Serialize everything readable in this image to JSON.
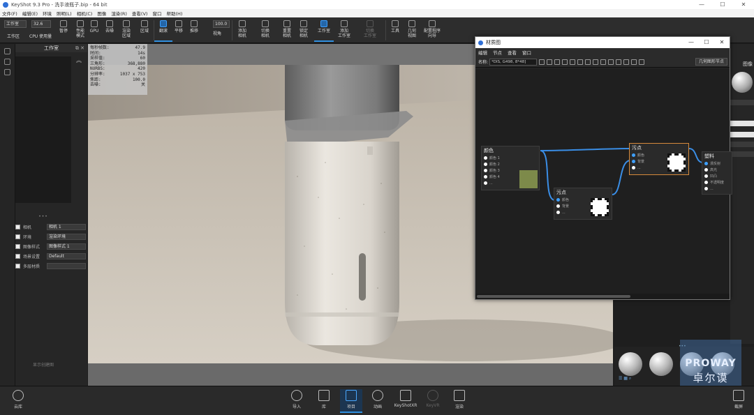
{
  "window": {
    "title": "KeyShot 9.3 Pro  -  洗手液瓶子.bip  -  64 bit",
    "controls": [
      "—",
      "☐",
      "✕"
    ]
  },
  "menu": [
    "文件(F)",
    "编辑(E)",
    "环境",
    "照明(L)",
    "相机(C)",
    "图像",
    "渲染(R)",
    "查看(V)",
    "窗口",
    "帮助(H)"
  ],
  "toolbar": {
    "workspace_value": "工作室",
    "workspace_label": "工作区",
    "cpu_value": "32.6",
    "cpu_label": "CPU 使用量",
    "zoom_value": "100.0",
    "items": [
      {
        "key": "pause",
        "label": "暂停"
      },
      {
        "key": "perf",
        "label": "性能\n模式"
      },
      {
        "key": "gpu",
        "label": "GPU"
      },
      {
        "key": "denoise",
        "label": "去噪"
      },
      {
        "key": "render",
        "label": "渲染\n区域"
      },
      {
        "key": "region",
        "label": "区域"
      },
      {
        "key": "tumble",
        "label": "翻滚"
      },
      {
        "key": "pan",
        "label": "平移"
      },
      {
        "key": "dolly",
        "label": "推移"
      },
      {
        "key": "fov",
        "label": "视角"
      },
      {
        "key": "addcam",
        "label": "添加\n相机"
      },
      {
        "key": "switchcam",
        "label": "切换\n相机"
      },
      {
        "key": "resetcam",
        "label": "重置\n相机"
      },
      {
        "key": "lockcam",
        "label": "锁定\n相机"
      },
      {
        "key": "studio",
        "label": "工作室"
      },
      {
        "key": "addstudio",
        "label": "添加\n工作室"
      },
      {
        "key": "switchstudio",
        "label": "切换\n工作室"
      },
      {
        "key": "tools",
        "label": "工具"
      },
      {
        "key": "geoview",
        "label": "几何\n视图"
      },
      {
        "key": "config",
        "label": "配置程序\n向导"
      }
    ]
  },
  "left_panel": {
    "title": "工作室",
    "footer": "显示创建图",
    "rows": [
      {
        "name": "相机",
        "value": "相机 1"
      },
      {
        "name": "环境",
        "value": "渲染环境"
      },
      {
        "name": "图像样式",
        "value": "图像样式 1"
      },
      {
        "name": "场景设置",
        "value": "Default"
      },
      {
        "name": "多层材质",
        "value": ""
      }
    ]
  },
  "stats": [
    {
      "k": "每秒帧数:",
      "v": "47.9"
    },
    {
      "k": "时间:",
      "v": "14s"
    },
    {
      "k": "采样值:",
      "v": "60"
    },
    {
      "k": "三角形:",
      "v": "368,880"
    },
    {
      "k": "NURBS:",
      "v": "420"
    },
    {
      "k": "分辨率:",
      "v": "1037 x 753"
    },
    {
      "k": "焦距:",
      "v": "100.0"
    },
    {
      "k": "去噪:",
      "v": "关"
    }
  ],
  "material_graph": {
    "title": "材质图",
    "menu": [
      "编辑",
      "节点",
      "查看",
      "窗口"
    ],
    "name_label": "名称:",
    "name_value": "*DIS, G498, 8*48]",
    "geo_button": "几何图形节点",
    "nodes": {
      "texture": {
        "title": "颜色",
        "ports": [
          "颜色 1",
          "颜色 2",
          "颜色 3",
          "颜色 4",
          "..."
        ]
      },
      "spots": {
        "title": "污点",
        "ports": [
          "颜色",
          "背景",
          "..."
        ]
      },
      "spots2": {
        "title": "污点",
        "ports": [
          "颜色",
          "背景",
          "..."
        ]
      },
      "plastic": {
        "title": "塑料",
        "ports": [
          "漫反射",
          "高光",
          "凹凸",
          "不透明度",
          "..."
        ]
      }
    }
  },
  "right_panel": {
    "label": "图像"
  },
  "bottom_bar": [
    {
      "key": "cloud",
      "label": "云库"
    },
    {
      "key": "import",
      "label": "导入"
    },
    {
      "key": "library",
      "label": "库"
    },
    {
      "key": "project",
      "label": "项目"
    },
    {
      "key": "animation",
      "label": "动画"
    },
    {
      "key": "keyshotxr",
      "label": "KeyShotXR"
    },
    {
      "key": "keyvr",
      "label": "KeyVR"
    },
    {
      "key": "render",
      "label": "渲染"
    },
    {
      "key": "screenshot",
      "label": "截屏"
    }
  ],
  "watermark": {
    "line1": "PROWAY",
    "line2": "卓尔谟"
  },
  "colors": {
    "accent": "#2f8fe0",
    "link": "#3ea0ff",
    "selected_node": "#d68a3c"
  }
}
